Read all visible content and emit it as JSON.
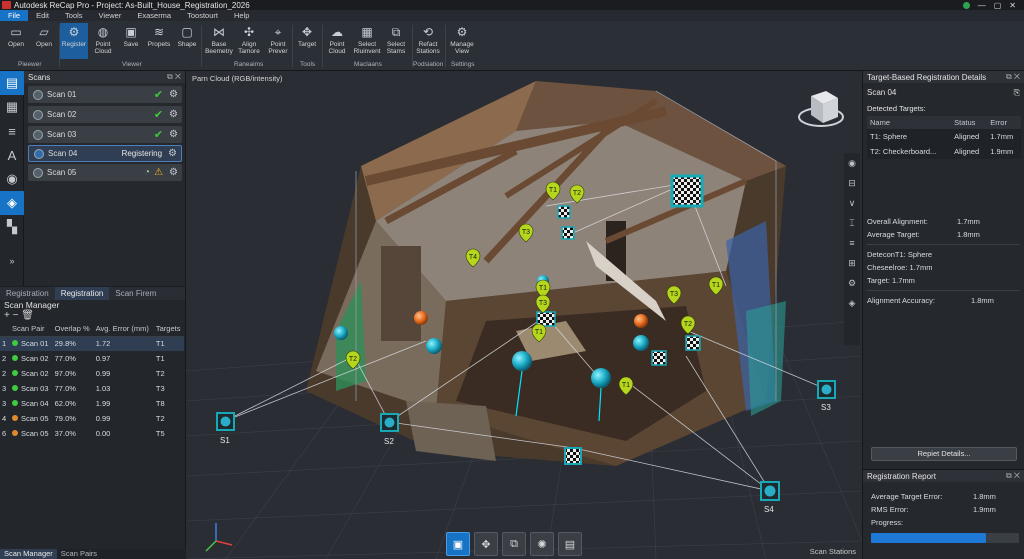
{
  "window": {
    "title": "Autodesk ReCap Pro - Project: As-Built_House_Registration_2026",
    "controls": [
      "—",
      "▢",
      "✕"
    ]
  },
  "menu": [
    "File",
    "Edit",
    "Tools",
    "Viewer",
    "Exaserma",
    "Toostourt",
    "Help"
  ],
  "ribbon": {
    "buttons": [
      {
        "label": "Open",
        "icon": "folder-icon"
      },
      {
        "label": "Open",
        "icon": "folder-open-icon"
      },
      {
        "label": "Register",
        "icon": "register-icon"
      },
      {
        "label": "Point Cloud",
        "icon": "globe-icon"
      },
      {
        "label": "Save",
        "icon": "save-icon"
      },
      {
        "label": "Propets",
        "icon": "layers-icon"
      },
      {
        "label": "Shape",
        "icon": "shape-icon"
      },
      {
        "label": "Base Beemetry",
        "icon": "network-icon"
      },
      {
        "label": "Align Tamore",
        "icon": "align-icon"
      },
      {
        "label": "Point Prever",
        "icon": "pin-icon"
      },
      {
        "label": "Target",
        "icon": "target-icon"
      },
      {
        "label": "Point Cloud",
        "icon": "cloud-icon"
      },
      {
        "label": "Select Rluinvent",
        "icon": "grid-icon"
      },
      {
        "label": "Select Stams",
        "icon": "stack-icon"
      },
      {
        "label": "Refact Stations",
        "icon": "refresh-icon"
      },
      {
        "label": "Manage View",
        "icon": "gear-icon"
      }
    ],
    "groups": [
      "Pieewer",
      "Viewer",
      "Raneaims",
      "Tools",
      "Maclaans",
      "Podsiation",
      "Settings"
    ]
  },
  "scans_panel": {
    "title": "Scans",
    "items": [
      {
        "name": "Scan 01",
        "status": "",
        "state": "ok"
      },
      {
        "name": "Scan 02",
        "status": "",
        "state": "ok"
      },
      {
        "name": "Scan 03",
        "status": "",
        "state": "ok"
      },
      {
        "name": "Scan 04",
        "status": "Registering",
        "state": "registering"
      },
      {
        "name": "Scan 05",
        "status": "",
        "state": "warning"
      }
    ]
  },
  "left_tabs": [
    "Registration",
    "Registration",
    "Scan Firem"
  ],
  "scan_manager": {
    "title": "Scan Manager",
    "tools": "+ − 🗑",
    "headers": [
      "Scan Pair",
      "Overlap %",
      "Avg. Error (mm)",
      "Targets"
    ],
    "rows": [
      {
        "n": "1",
        "pair": "Scan 01",
        "overlap": "29.8%",
        "error": "1.72",
        "targets": "T1",
        "dot": "g"
      },
      {
        "n": "2",
        "pair": "Scan 02",
        "overlap": "77.0%",
        "error": "0.97",
        "targets": "T1",
        "dot": "g"
      },
      {
        "n": "2",
        "pair": "Scan 02",
        "overlap": "97.0%",
        "error": "0.99",
        "targets": "T2",
        "dot": "g"
      },
      {
        "n": "3",
        "pair": "Scan 03",
        "overlap": "77.0%",
        "error": "1.03",
        "targets": "T3",
        "dot": "g"
      },
      {
        "n": "3",
        "pair": "Scan 04",
        "overlap": "62.0%",
        "error": "1.99",
        "targets": "T8",
        "dot": "g"
      },
      {
        "n": "4",
        "pair": "Scan 05",
        "overlap": "79.0%",
        "error": "0.99",
        "targets": "T2",
        "dot": "o"
      },
      {
        "n": "6",
        "pair": "Scan 05",
        "overlap": "37.0%",
        "error": "0.00",
        "targets": "T5",
        "dot": "o"
      }
    ]
  },
  "bottom_left_tabs": [
    "Scan Manager",
    "Scan Pairs"
  ],
  "viewport": {
    "label": "Parn Cloud (RGB/intensity)",
    "status": "Scan Stations",
    "stations": [
      "S1",
      "S2",
      "S3",
      "S4"
    ],
    "targets": [
      "T1",
      "T2",
      "T3",
      "T4",
      "T1",
      "T3",
      "T1",
      "T3",
      "T1",
      "T2",
      "T1",
      "T2"
    ]
  },
  "details": {
    "title": "Target-Based Registration Details",
    "scan": "Scan 04",
    "detected_label": "Detected Targets:",
    "headers": [
      "Name",
      "Status",
      "Error"
    ],
    "rows": [
      {
        "name": "T1: Sphere",
        "status": "Aligned",
        "error": "1.7mm"
      },
      {
        "name": "T2: Checkerboard...",
        "status": "Aligned",
        "error": "1.9mm"
      }
    ],
    "overall_label": "Overall Alignment:",
    "overall_value": "1.7mm",
    "avg_label": "Average Target:",
    "avg_value": "1.8mm",
    "detect_line": "DeteconT1: Sphere",
    "checker_line": "Cheseelroe: 1.7mm",
    "target_line": "Target: 1.7mm",
    "accuracy_label": "Alignment Accuracy:",
    "accuracy_value": "1.8mm",
    "report_button": "Repiet Details..."
  },
  "report": {
    "title": "Registration Report",
    "avg_label": "Average Target Error:",
    "avg_value": "1.8mm",
    "rms_label": "RMS Error:",
    "rms_value": "1.9mm",
    "progress_label": "Progress:",
    "progress": 0.78
  },
  "colors": {
    "accent": "#1673c5",
    "ok": "#3ecb3e",
    "warn": "#f2b61d",
    "target": "#17a9b5",
    "marker": "#b6d61e"
  }
}
